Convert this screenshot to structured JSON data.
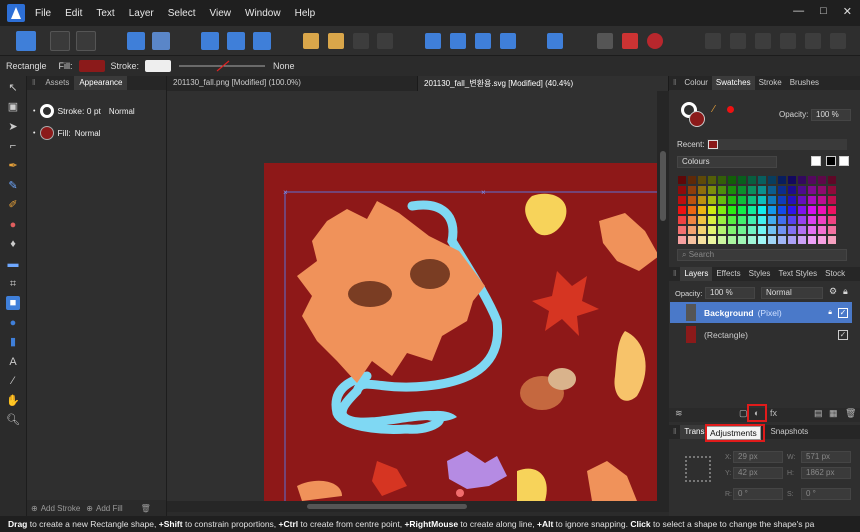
{
  "menubar": {
    "items": [
      "File",
      "Edit",
      "Text",
      "Layer",
      "Select",
      "View",
      "Window",
      "Help"
    ],
    "window_buttons": [
      "—",
      "□",
      "✕"
    ]
  },
  "context": {
    "shape_label": "Rectangle",
    "fill_label": "Fill:",
    "stroke_label": "Stroke:",
    "stroke_style": "None",
    "fill_color": "#8b1a1a",
    "stroke_color": "#eeeeee"
  },
  "left_panel": {
    "tabs": [
      "Assets",
      "Appearance"
    ],
    "stroke_row": {
      "label": "Stroke: 0 pt",
      "mode": "Normal"
    },
    "fill_row": {
      "label": "Fill:",
      "mode": "Normal"
    },
    "add_stroke": "Add Stroke",
    "add_fill": "Add Fill"
  },
  "document_tabs": [
    "201130_fall.png [Modified] (100.0%)",
    "201130_fall_변환용.svg [Modified] (40.4%)"
  ],
  "swatches_panel": {
    "tabs": [
      "Colour",
      "Swatches",
      "Stroke",
      "Brushes"
    ],
    "opacity_label": "Opacity:",
    "opacity_value": "100 %",
    "recent_label": "Recent:",
    "palette_name": "Colours",
    "search_placeholder": "Search"
  },
  "layers_panel": {
    "tabs": [
      "Layers",
      "Effects",
      "Styles",
      "Text Styles",
      "Stock"
    ],
    "opacity_label": "Opacity:",
    "opacity_value": "100 %",
    "blend_mode": "Normal",
    "layers": [
      {
        "name": "Background",
        "type": "(Pixel)"
      },
      {
        "name": "(Rectangle)",
        "type": ""
      }
    ]
  },
  "transform_panel": {
    "tabs": [
      "Trans",
      "Snapshots"
    ],
    "x_label": "X:",
    "x_value": "29 px",
    "y_label": "Y:",
    "y_value": "42 px",
    "w_label": "W:",
    "w_value": "571 px",
    "h_label": "H:",
    "h_value": "1862 px",
    "r_label": "R:",
    "r_value": "0 °",
    "s_label": "S:",
    "s_value": "0 °"
  },
  "tooltip": "Adjustments",
  "statusbar": {
    "parts": [
      {
        "bold": "Drag",
        "text": " to create a new Rectangle shape, "
      },
      {
        "bold": "+Shift",
        "text": " to constrain proportions, "
      },
      {
        "bold": "+Ctrl",
        "text": " to create from centre point, "
      },
      {
        "bold": "+RightMouse",
        "text": " to create along line, "
      },
      {
        "bold": "+Alt",
        "text": " to ignore snapping. "
      },
      {
        "bold": "Click",
        "text": " to select a shape to change the shape's pa"
      }
    ]
  },
  "colors": {
    "canvas_bg": "#8e1818",
    "selection": "#5b6fd6",
    "accent_blue": "#3f7fd9"
  }
}
